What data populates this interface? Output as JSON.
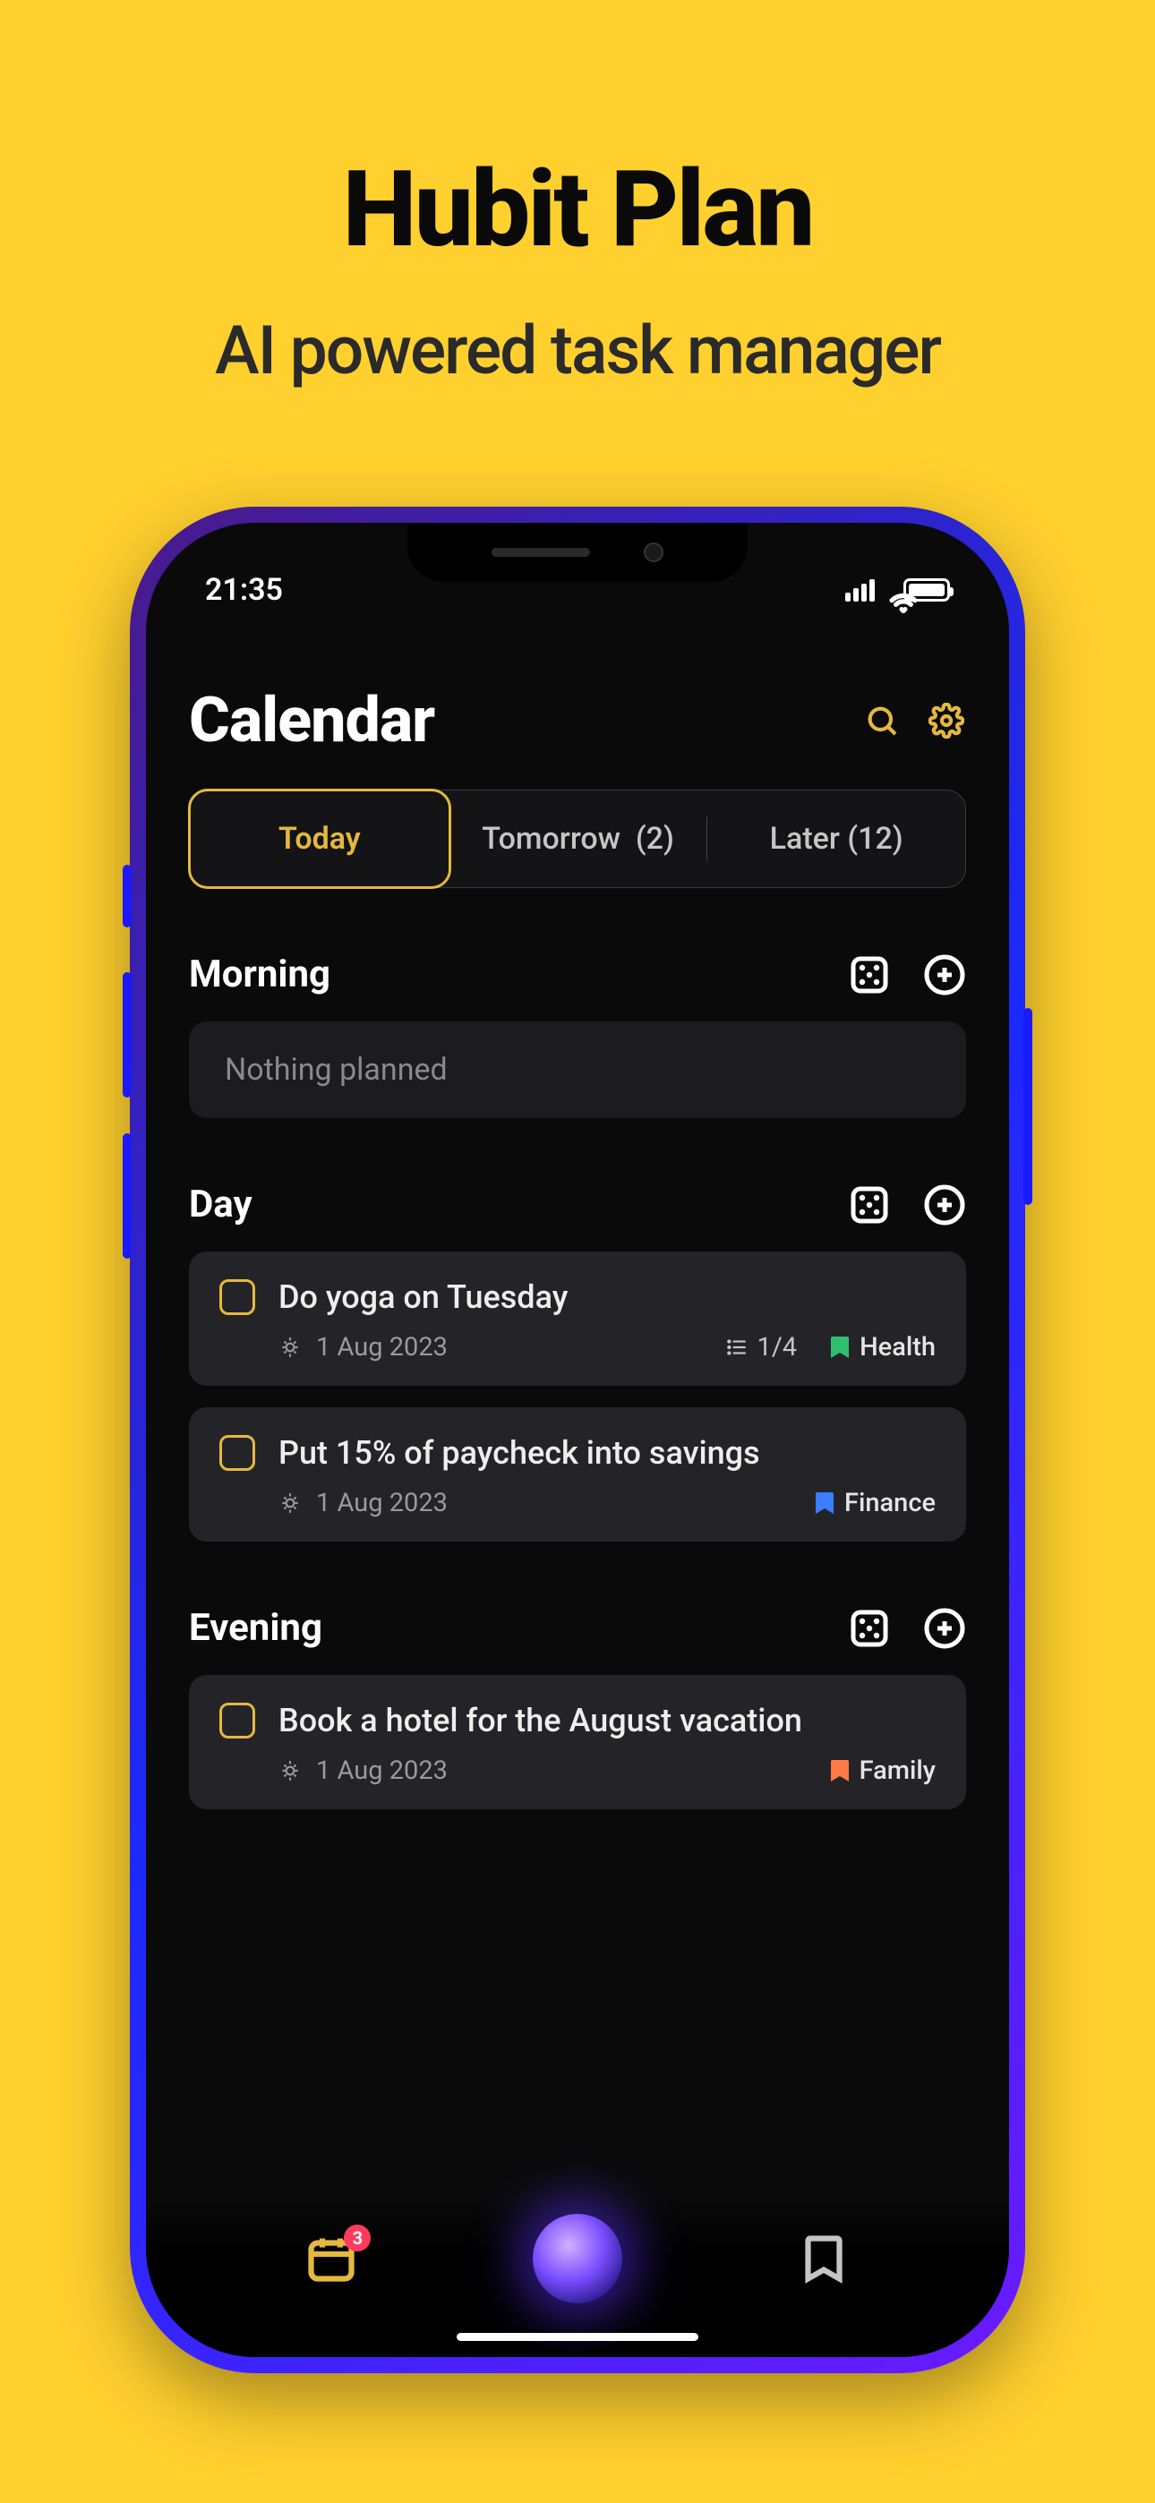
{
  "promo": {
    "title": "Hubit Plan",
    "subtitle": "AI powered task manager"
  },
  "status": {
    "time": "21:35"
  },
  "header": {
    "title": "Calendar"
  },
  "tabs": {
    "today": "Today",
    "tomorrow_label": "Tomorrow",
    "tomorrow_count": "(2)",
    "later_label": "Later",
    "later_count": "(12)"
  },
  "sections": {
    "morning": {
      "title": "Morning",
      "empty": "Nothing planned"
    },
    "day": {
      "title": "Day",
      "tasks": [
        {
          "title": "Do yoga on Tuesday",
          "date": "1 Aug 2023",
          "progress": "1/4",
          "tag": "Health",
          "tag_color": "green"
        },
        {
          "title": "Put 15% of paycheck into savings",
          "date": "1 Aug 2023",
          "tag": "Finance",
          "tag_color": "blue"
        }
      ]
    },
    "evening": {
      "title": "Evening",
      "tasks": [
        {
          "title": "Book a hotel for the August vacation",
          "date": "1 Aug 2023",
          "tag": "Family",
          "tag_color": "orange"
        }
      ]
    }
  },
  "nav": {
    "badge": "3"
  }
}
